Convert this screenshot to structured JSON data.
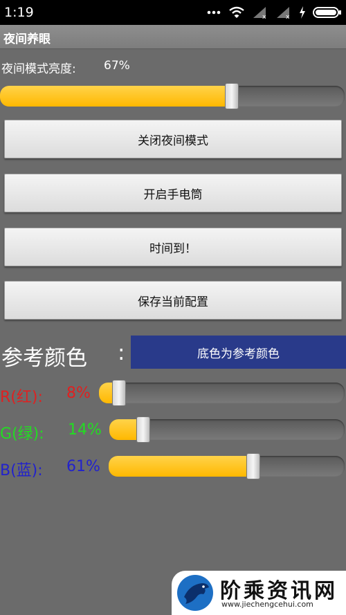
{
  "status": {
    "time": "1:19"
  },
  "app": {
    "title": "夜间养眼"
  },
  "brightness": {
    "label": "夜间模式亮度:",
    "value_text": "67%",
    "level": 0.67
  },
  "buttons": {
    "close_night": "关闭夜间模式",
    "flashlight": "开启手电筒",
    "time_up": "时间到！",
    "save_config": "保存当前配置"
  },
  "reference": {
    "label": "参考颜色",
    "colon": ":",
    "swatch_text": "底色为参考颜色",
    "swatch_color": "#293a8a"
  },
  "rgb": {
    "r": {
      "label": "R(红):",
      "value_text": "8%",
      "level": 0.08,
      "color": "#e02020"
    },
    "g": {
      "label": "G(绿):",
      "value_text": "14%",
      "level": 0.14,
      "color": "#22dd22"
    },
    "b": {
      "label": "B(蓝):",
      "value_text": "61%",
      "level": 0.61,
      "color": "#2222cc"
    }
  },
  "watermark": {
    "title": "阶乘资讯网",
    "url": "www.jiechengcehui.com"
  }
}
